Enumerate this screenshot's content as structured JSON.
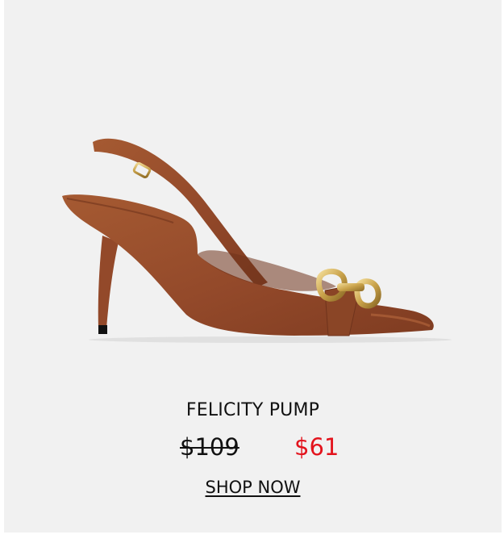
{
  "product": {
    "name": "FELICITY PUMP",
    "original_price": "$109",
    "sale_price": "$61",
    "cta_label": "SHOP NOW"
  },
  "colors": {
    "background": "#f1f1f1",
    "text": "#111111",
    "sale": "#e3141d",
    "leather": "#9b4f2c",
    "hardware": "#c9a24a"
  },
  "icons": {
    "product_image": "slingback-pump-shoe-illustration"
  }
}
